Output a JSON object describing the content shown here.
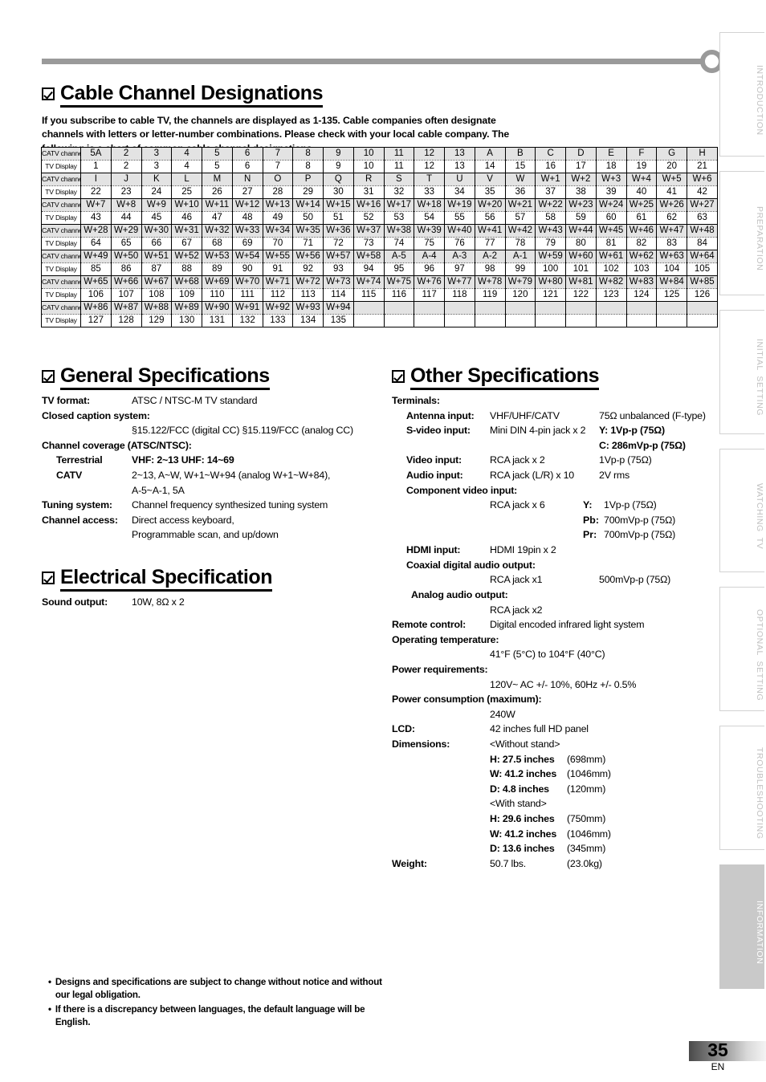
{
  "page": {
    "number": "35",
    "language_code": "EN"
  },
  "side_tabs": [
    {
      "label": "INTRODUCTION",
      "active": false
    },
    {
      "label": "PREPARATION",
      "active": false
    },
    {
      "label": "INITIAL  SETTING",
      "active": false
    },
    {
      "label": "WATCHING  TV",
      "active": false
    },
    {
      "label": "OPTIONAL  SETTING",
      "active": false
    },
    {
      "label": "TROUBLESHOOTING",
      "active": false
    },
    {
      "label": "INFORMATION",
      "active": true
    }
  ],
  "cable_section": {
    "title": "Cable Channel Designations",
    "intro": "If you subscribe to cable TV, the channels are displayed as 1-135. Cable companies often designate channels with letters or letter-number combinations. Please check with your local cable company. The following is a chart of common cable channel designations.",
    "row_label_catv": "CATV channel",
    "row_label_display": "TV Display",
    "rows": [
      {
        "catv": [
          "5A",
          "2",
          "3",
          "4",
          "5",
          "6",
          "7",
          "8",
          "9",
          "10",
          "11",
          "12",
          "13",
          "A",
          "B",
          "C",
          "D",
          "E",
          "F",
          "G",
          "H"
        ],
        "display": [
          "1",
          "2",
          "3",
          "4",
          "5",
          "6",
          "7",
          "8",
          "9",
          "10",
          "11",
          "12",
          "13",
          "14",
          "15",
          "16",
          "17",
          "18",
          "19",
          "20",
          "21"
        ]
      },
      {
        "catv": [
          "I",
          "J",
          "K",
          "L",
          "M",
          "N",
          "O",
          "P",
          "Q",
          "R",
          "S",
          "T",
          "U",
          "V",
          "W",
          "W+1",
          "W+2",
          "W+3",
          "W+4",
          "W+5",
          "W+6"
        ],
        "display": [
          "22",
          "23",
          "24",
          "25",
          "26",
          "27",
          "28",
          "29",
          "30",
          "31",
          "32",
          "33",
          "34",
          "35",
          "36",
          "37",
          "38",
          "39",
          "40",
          "41",
          "42"
        ]
      },
      {
        "catv": [
          "W+7",
          "W+8",
          "W+9",
          "W+10",
          "W+11",
          "W+12",
          "W+13",
          "W+14",
          "W+15",
          "W+16",
          "W+17",
          "W+18",
          "W+19",
          "W+20",
          "W+21",
          "W+22",
          "W+23",
          "W+24",
          "W+25",
          "W+26",
          "W+27"
        ],
        "display": [
          "43",
          "44",
          "45",
          "46",
          "47",
          "48",
          "49",
          "50",
          "51",
          "52",
          "53",
          "54",
          "55",
          "56",
          "57",
          "58",
          "59",
          "60",
          "61",
          "62",
          "63"
        ]
      },
      {
        "catv": [
          "W+28",
          "W+29",
          "W+30",
          "W+31",
          "W+32",
          "W+33",
          "W+34",
          "W+35",
          "W+36",
          "W+37",
          "W+38",
          "W+39",
          "W+40",
          "W+41",
          "W+42",
          "W+43",
          "W+44",
          "W+45",
          "W+46",
          "W+47",
          "W+48"
        ],
        "display": [
          "64",
          "65",
          "66",
          "67",
          "68",
          "69",
          "70",
          "71",
          "72",
          "73",
          "74",
          "75",
          "76",
          "77",
          "78",
          "79",
          "80",
          "81",
          "82",
          "83",
          "84"
        ]
      },
      {
        "catv": [
          "W+49",
          "W+50",
          "W+51",
          "W+52",
          "W+53",
          "W+54",
          "W+55",
          "W+56",
          "W+57",
          "W+58",
          "A-5",
          "A-4",
          "A-3",
          "A-2",
          "A-1",
          "W+59",
          "W+60",
          "W+61",
          "W+62",
          "W+63",
          "W+64"
        ],
        "display": [
          "85",
          "86",
          "87",
          "88",
          "89",
          "90",
          "91",
          "92",
          "93",
          "94",
          "95",
          "96",
          "97",
          "98",
          "99",
          "100",
          "101",
          "102",
          "103",
          "104",
          "105"
        ]
      },
      {
        "catv": [
          "W+65",
          "W+66",
          "W+67",
          "W+68",
          "W+69",
          "W+70",
          "W+71",
          "W+72",
          "W+73",
          "W+74",
          "W+75",
          "W+76",
          "W+77",
          "W+78",
          "W+79",
          "W+80",
          "W+81",
          "W+82",
          "W+83",
          "W+84",
          "W+85"
        ],
        "display": [
          "106",
          "107",
          "108",
          "109",
          "110",
          "111",
          "112",
          "113",
          "114",
          "115",
          "116",
          "117",
          "118",
          "119",
          "120",
          "121",
          "122",
          "123",
          "124",
          "125",
          "126"
        ]
      },
      {
        "catv": [
          "W+86",
          "W+87",
          "W+88",
          "W+89",
          "W+90",
          "W+91",
          "W+92",
          "W+93",
          "W+94",
          "",
          "",
          "",
          "",
          "",
          "",
          "",
          "",
          "",
          "",
          "",
          ""
        ],
        "display": [
          "127",
          "128",
          "129",
          "130",
          "131",
          "132",
          "133",
          "134",
          "135",
          "",
          "",
          "",
          "",
          "",
          "",
          "",
          "",
          "",
          "",
          "",
          ""
        ]
      }
    ]
  },
  "general_spec": {
    "title": "General Specifications",
    "tv_format_key": "TV format:",
    "tv_format_val": "ATSC / NTSC-M TV standard",
    "cc_key": "Closed caption system:",
    "cc_val": "§15.122/FCC (digital CC)    §15.119/FCC (analog CC)",
    "coverage_key": "Channel coverage (ATSC/NTSC):",
    "terrestrial_key": "Terrestrial",
    "terrestrial_val": "VHF:  2~13    UHF:  14~69",
    "catv_key": "CATV",
    "catv_val_line1": "2~13, A~W, W+1~W+94 (analog W+1~W+84),",
    "catv_val_line2": "A-5~A-1, 5A",
    "tuning_key": "Tuning system:",
    "tuning_val": "Channel frequency synthesized tuning system",
    "access_key": "Channel access:",
    "access_val_line1": "Direct access keyboard,",
    "access_val_line2": "Programmable scan, and up/down"
  },
  "electrical_spec": {
    "title": "Electrical Specification",
    "sound_key": "Sound output:",
    "sound_val": "10W, 8Ω x 2"
  },
  "other_spec": {
    "title": "Other Specifications",
    "terminals_key": "Terminals:",
    "antenna_key": "Antenna input:",
    "antenna_val": "VHF/UHF/CATV",
    "antenna_spec": "75Ω unbalanced (F-type)",
    "svideo_key": "S-video input:",
    "svideo_val": "Mini DIN 4-pin jack x 2",
    "svideo_spec_y": "Y: 1Vp-p (75Ω)",
    "svideo_spec_c": "C: 286mVp-p (75Ω)",
    "video_key": "Video input:",
    "video_val": "RCA jack x 2",
    "video_spec": "1Vp-p (75Ω)",
    "audio_key": "Audio input:",
    "audio_val": "RCA jack (L/R) x 10",
    "audio_spec": "2V rms",
    "component_key": "Component video input:",
    "component_val": "RCA jack x 6",
    "component_y_key": "Y:",
    "component_y_val": "1Vp-p (75Ω)",
    "component_pb_key": "Pb:",
    "component_pb_val": "700mVp-p (75Ω)",
    "component_pr_key": "Pr:",
    "component_pr_val": "700mVp-p (75Ω)",
    "hdmi_key": "HDMI input:",
    "hdmi_val": "HDMI 19pin x 2",
    "coax_key": "Coaxial digital audio output:",
    "coax_val": "RCA jack x1",
    "coax_spec": "500mVp-p (75Ω)",
    "analog_out_key": "Analog audio output:",
    "analog_out_val": "RCA jack x2",
    "remote_key": "Remote control:",
    "remote_val": "Digital encoded infrared light system",
    "optemp_key": "Operating temperature:",
    "optemp_val": "41°F (5°C) to 104°F (40°C)",
    "power_req_key": "Power requirements:",
    "power_req_val": "120V~ AC +/- 10%, 60Hz +/- 0.5%",
    "power_con_key": "Power consumption (maximum):",
    "power_con_val": "240W",
    "lcd_key": "LCD:",
    "lcd_val": "42 inches full HD panel",
    "dim_key": "Dimensions:",
    "dim_without": "<Without stand>",
    "dim_wo_h_key": "H:  27.5 inches",
    "dim_wo_h_val": "(698mm)",
    "dim_wo_w_key": "W: 41.2 inches",
    "dim_wo_w_val": "(1046mm)",
    "dim_wo_d_key": "D:  4.8 inches",
    "dim_wo_d_val": "(120mm)",
    "dim_with": "<With stand>",
    "dim_w_h_key": "H:  29.6 inches",
    "dim_w_h_val": "(750mm)",
    "dim_w_w_key": "W: 41.2 inches",
    "dim_w_w_val": "(1046mm)",
    "dim_w_d_key": "D:  13.6 inches",
    "dim_w_d_val": "(345mm)",
    "weight_key": "Weight:",
    "weight_val": "50.7 lbs.",
    "weight_metric": "(23.0kg)"
  },
  "notes": {
    "bullet": "•",
    "items": [
      "Designs and specifications are subject to change without notice and without our legal obligation.",
      "If there is a discrepancy between languages, the default language will be English."
    ]
  }
}
